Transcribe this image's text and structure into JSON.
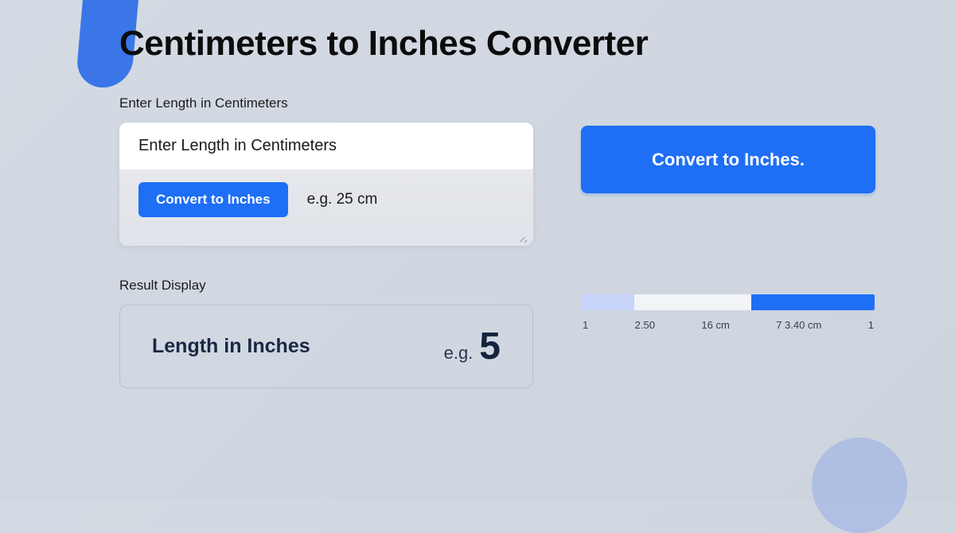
{
  "title": "Centimeters to Inches Converter",
  "input": {
    "section_label": "Enter Length in Centimeters",
    "placeholder": "Enter Length  in Centimeters",
    "convert_button": "Convert to Inches",
    "hint": "e.g. 25 cm"
  },
  "main_button": "Convert to Inches.",
  "result": {
    "section_label": "Result Display",
    "label": "Length in Inches",
    "prefix": "e.g.",
    "value": "5"
  },
  "ruler": {
    "ticks": [
      "1",
      "2.50",
      "16 cm",
      "7 3.40 cm",
      "1"
    ]
  },
  "colors": {
    "primary": "#1e6ff5",
    "background": "#d4dae3"
  }
}
